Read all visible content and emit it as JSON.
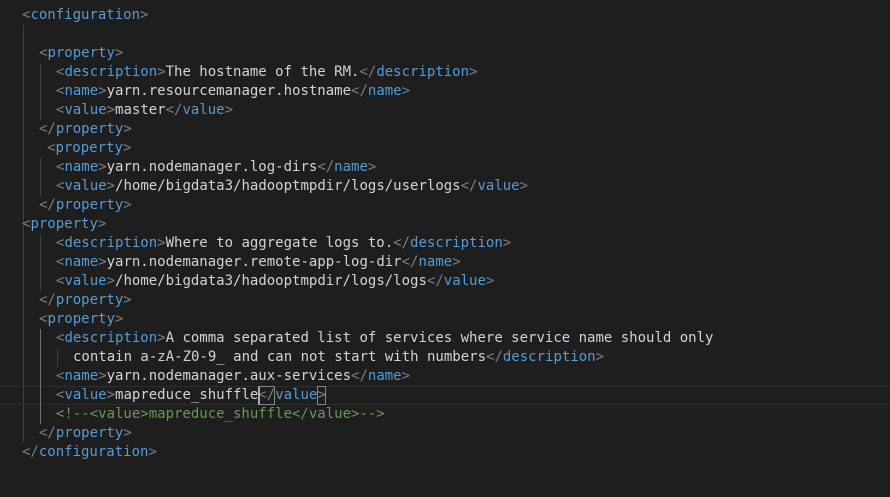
{
  "editor": {
    "theme_colors": {
      "background": "#1e1e1e",
      "tag": "#569cd6",
      "bracket": "#808080",
      "text": "#d4d4d4",
      "comment": "#6a9955"
    },
    "lines": [
      [
        "<",
        "configuration",
        ">"
      ],
      [],
      [
        "<",
        "property",
        ">"
      ],
      [
        "<",
        "description",
        ">",
        "The hostname of the RM.",
        "</",
        "description",
        ">"
      ],
      [
        "<",
        "name",
        ">",
        "yarn.resourcemanager.hostname",
        "</",
        "name",
        ">"
      ],
      [
        "<",
        "value",
        ">",
        "master",
        "</",
        "value",
        ">"
      ],
      [
        "</",
        "property",
        ">"
      ],
      [
        "<",
        "property",
        ">"
      ],
      [
        "<",
        "name",
        ">",
        "yarn.nodemanager.log-dirs",
        "</",
        "name",
        ">"
      ],
      [
        "<",
        "value",
        ">",
        "/home/bigdata3/hadooptmpdir/logs/userlogs",
        "</",
        "value",
        ">"
      ],
      [
        "</",
        "property",
        ">"
      ],
      [
        "<",
        "property",
        ">"
      ],
      [
        "<",
        "description",
        ">",
        "Where to aggregate logs to.",
        "</",
        "description",
        ">"
      ],
      [
        "<",
        "name",
        ">",
        "yarn.nodemanager.remote-app-log-dir",
        "</",
        "name",
        ">"
      ],
      [
        "<",
        "value",
        ">",
        "/home/bigdata3/hadooptmpdir/logs/logs",
        "</",
        "value",
        ">"
      ],
      [
        "</",
        "property",
        ">"
      ],
      [
        "<",
        "property",
        ">"
      ],
      [
        "<",
        "description",
        ">",
        "A comma separated list of services where service name should only"
      ],
      [
        "contain a-zA-Z0-9_ and can not start with numbers",
        "</",
        "description",
        ">"
      ],
      [
        "<",
        "name",
        ">",
        "yarn.nodemanager.aux-services",
        "</",
        "name",
        ">"
      ],
      [
        "<",
        "value",
        ">",
        "mapreduce_shuffle",
        "</",
        "value",
        ">"
      ],
      [
        "<!--<value>mapreduce_shuffle</value>-->"
      ],
      [
        "</",
        "property",
        ">"
      ],
      [
        "</",
        "configuration",
        ">"
      ]
    ]
  }
}
